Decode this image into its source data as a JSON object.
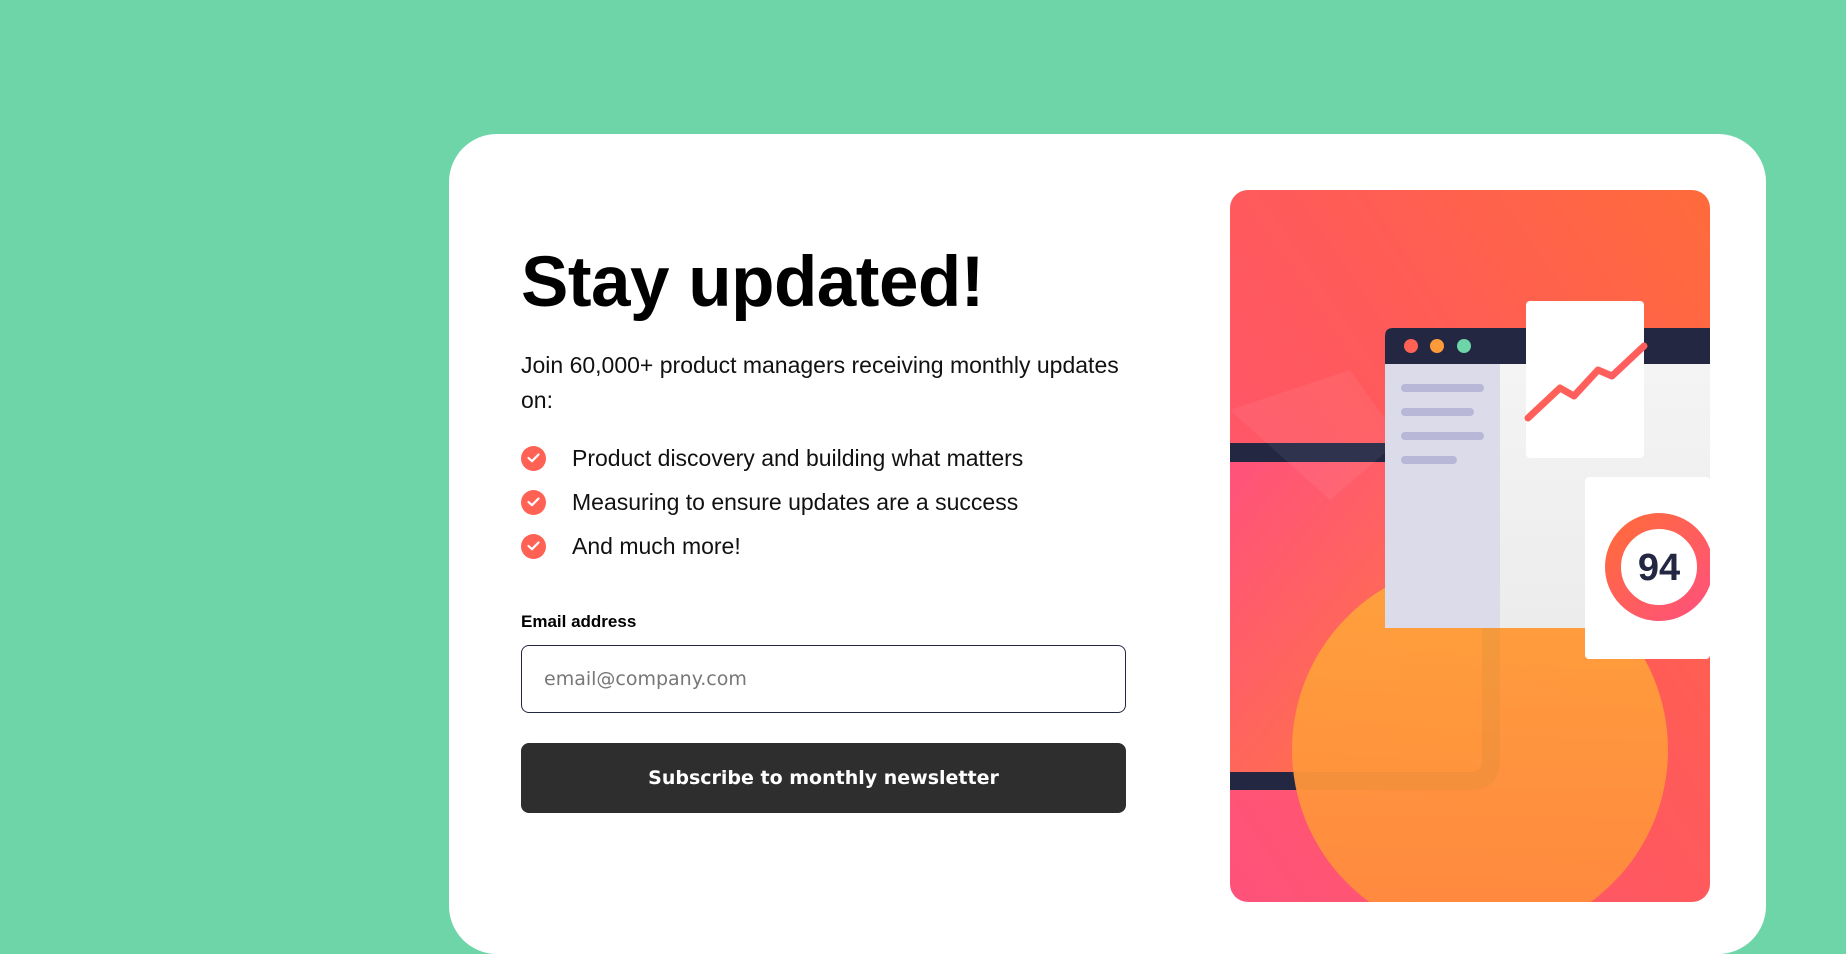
{
  "signup": {
    "title": "Stay updated!",
    "intro": "Join 60,000+ product managers receiving monthly updates on:",
    "features": [
      "Product discovery and building what matters",
      "Measuring to ensure updates are a success",
      "And much more!"
    ],
    "email_label": "Email address",
    "email_placeholder": "email@company.com",
    "email_value": "",
    "submit_label": "Subscribe to monthly newsletter"
  },
  "illustration": {
    "score": "94"
  },
  "colors": {
    "background": "#6dd5a7",
    "accent": "#ff6155",
    "button": "#2e2e2e",
    "text_dark": "#242742"
  },
  "icons": [
    "check-icon"
  ]
}
